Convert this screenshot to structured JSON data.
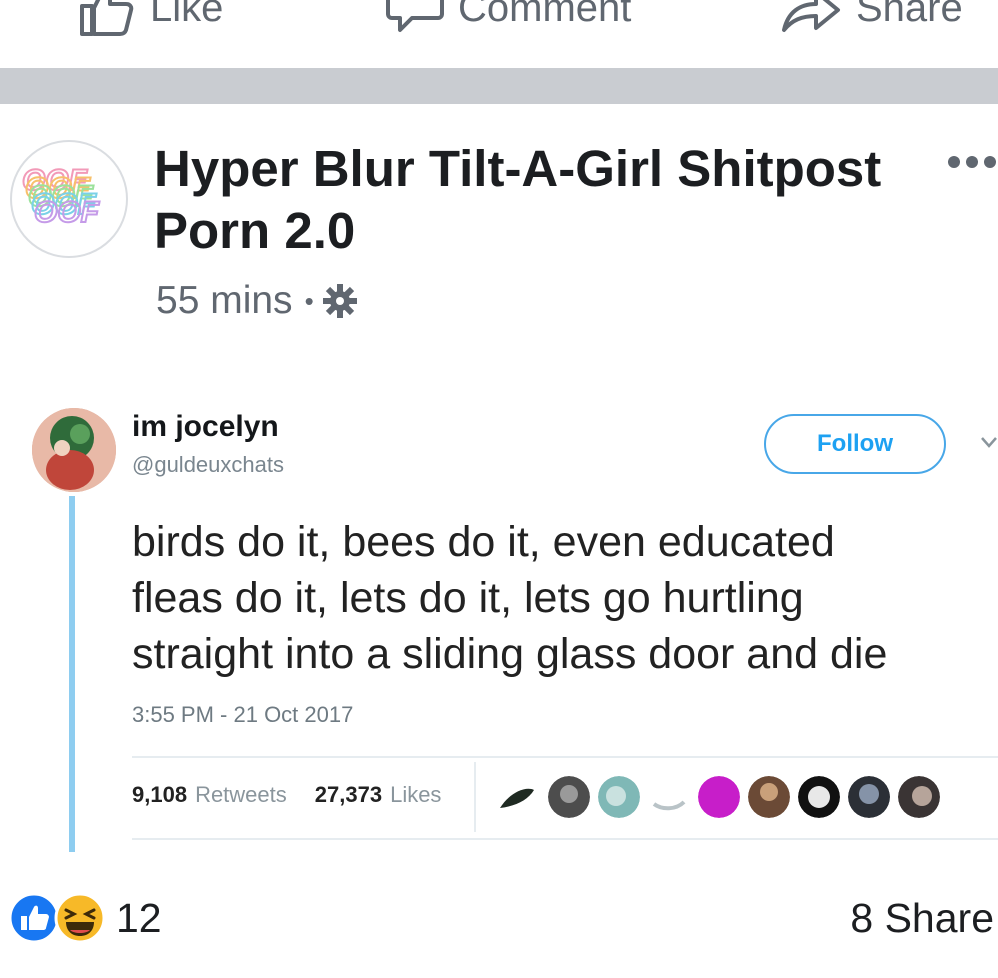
{
  "actions": {
    "like_label": "Like",
    "comment_label": "Comment",
    "share_label": "Share"
  },
  "post": {
    "page_name": "Hyper Blur Tilt-A-Girl Shitpost Porn 2.0",
    "avatar_text": "OOF",
    "timestamp": "55 mins",
    "separator_dot": "•",
    "privacy_icon": "gear-icon",
    "more_icon": "more-dots-icon"
  },
  "tweet": {
    "display_name": "im jocelyn",
    "handle": "@guldeuxchats",
    "follow_label": "Follow",
    "lines": [
      "birds do it, bees do it, even educated",
      "fleas do it, lets do it, lets go hurtling",
      "straight into a sliding glass door and die"
    ],
    "time": "3:55 PM - 21 Oct 2017",
    "retweets_count": "9,108",
    "retweets_label": "Retweets",
    "likes_count": "27,373",
    "likes_label": "Likes"
  },
  "footer": {
    "reaction_icons": [
      "like-reaction-icon",
      "haha-reaction-icon"
    ],
    "reaction_count": "12",
    "share_text": "8 Share"
  },
  "colors": {
    "separator": "#c9ccd1",
    "meta_text": "#606770",
    "twitter_blue": "#1da1f2",
    "thread_line": "#8ecdf0",
    "like_blue": "#1877f2",
    "haha_yellow": "#f7b928"
  }
}
